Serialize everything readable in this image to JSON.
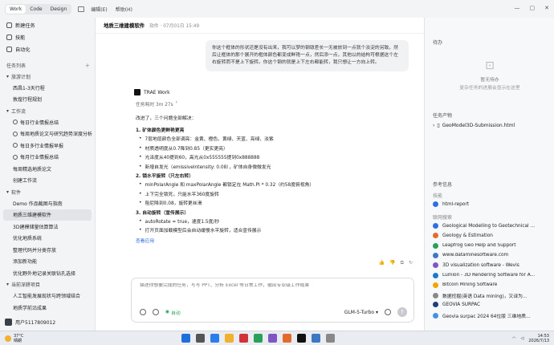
{
  "topbar": {
    "tabs": [
      "Work",
      "Code",
      "Design"
    ],
    "menu": [
      "编辑(E)",
      "帮助(H)"
    ]
  },
  "sidebar": {
    "top_items": [
      "新建任务",
      "技能",
      "自动化"
    ],
    "section_title": "任务列表",
    "groups": [
      {
        "title": "旅游计划",
        "items": [
          "西昌1-3天行程",
          "敦煌行程规划"
        ]
      },
      {
        "title": "工作流",
        "items": [
          "每日行业情报总结",
          "每周地质论文与研究趋势深度分析",
          "每日多行业情报早报",
          "每月行业情报总结",
          "每周精选地质论文",
          "创建工作流"
        ]
      },
      {
        "title": "软件",
        "items": [
          "Demo 作品截图与指南",
          "地质三维建模软件",
          "3D建模储量估算算法",
          "优化地质系统",
          "整理代码并分类存放",
          "添加新功能",
          "优化野外地记录关联钻孔选择"
        ]
      },
      {
        "title": "当前深耕项目",
        "items": [
          "人工智能发展现状与跨领域结合",
          "地质学前沿成果"
        ]
      }
    ],
    "user": "用户5117809012"
  },
  "main": {
    "title": "地质三维建模软件",
    "meta": "软件 · 07月01日 15:49",
    "user_message": "你这个框体的形状还是没有出来，我可以梦的钢墩差长一无被放到一点就个淡淀的另致，然后让框体的那个展开的框体颜色都变成鲜艳一点，然后添一点，其他以的结构可根据这个左右旋转而不是上下旋转。你这个钢的就是上下左右都能转，我只想让一方向上转。",
    "agent_name": "TRAE Work",
    "duration": "任务耗时 3m 27s",
    "intro": "改进了，三个问题全部解决：",
    "sections": [
      {
        "heading": "1. 矿体颜色更鲜艳更亮",
        "items": [
          "7层地层颜色全部调亮：金黄、橙色、黄绿、天蓝、亮绿、淡紫",
          "材质透明度从0.7降到0.85（更实更亮）",
          "光泽度从40提到60，高光从0x555555提到0x888888",
          "新增自发光（emissiveIntensity: 0.08），矿体自身微微发光"
        ]
      },
      {
        "heading": "2. 锁水平旋转（只左右转）",
        "items": [
          "minPolarAngle 和 maxPolarAngle 都锁定在 Math.PI * 0.32（约58度俯视角）",
          "上下完全锁死，只能水平360度旋转",
          "阻尼降到0.08，旋转更丝滑"
        ]
      },
      {
        "heading": "3. 自动旋转（宣传展示）",
        "items": [
          "autoRotate = true，速度1.5度/秒",
          "打开页面加载模型后会自动缓慢水平旋转，适合宣传展示"
        ]
      }
    ],
    "view_link": "查看应用",
    "composer_placeholder": "描述你想要完成的任务，写写 PPT、分析 Excel 等日常工作，输出专业级工作成果",
    "auto_label": "自动",
    "model": "GLM-5-Turbo"
  },
  "right": {
    "todo_title": "待办",
    "todo_empty_title": "暂无待办",
    "todo_empty_desc": "复杂任务的进展会显示在这里",
    "products_title": "任务产物",
    "product_file": "GeoModel3D-Submission.html",
    "refs_title": "参考信息",
    "skill_label": "技能",
    "skill_item": "html-report",
    "links_label": "联网搜索",
    "links": [
      "Geological Modelling to Geotechnical ...",
      "Geology & Estimation",
      "Leapfrog Geo Help and Support",
      "www.dataminesoftware.com",
      "3D visualization software - Wevis",
      "Lumion - 3D Rendering Software for A...",
      "Bitcoin Mining Software",
      "数据挖掘(英语 Data mining)，又译为...",
      "GEOVIA SURPAC",
      "Geovia surpac 2024 64位版 三维地质..."
    ],
    "link_colors": [
      "#2f6fdf",
      "#e36b2b",
      "#2aa05a",
      "#3e77c2",
      "#7e57c2",
      "#1b7ad0",
      "#f2a400",
      "#888888",
      "#1d3f7a",
      "#4a90e2"
    ]
  },
  "taskbar": {
    "temp": "37°C",
    "condition": "晴朗",
    "time": "14:53",
    "date": "2026/7/13"
  }
}
